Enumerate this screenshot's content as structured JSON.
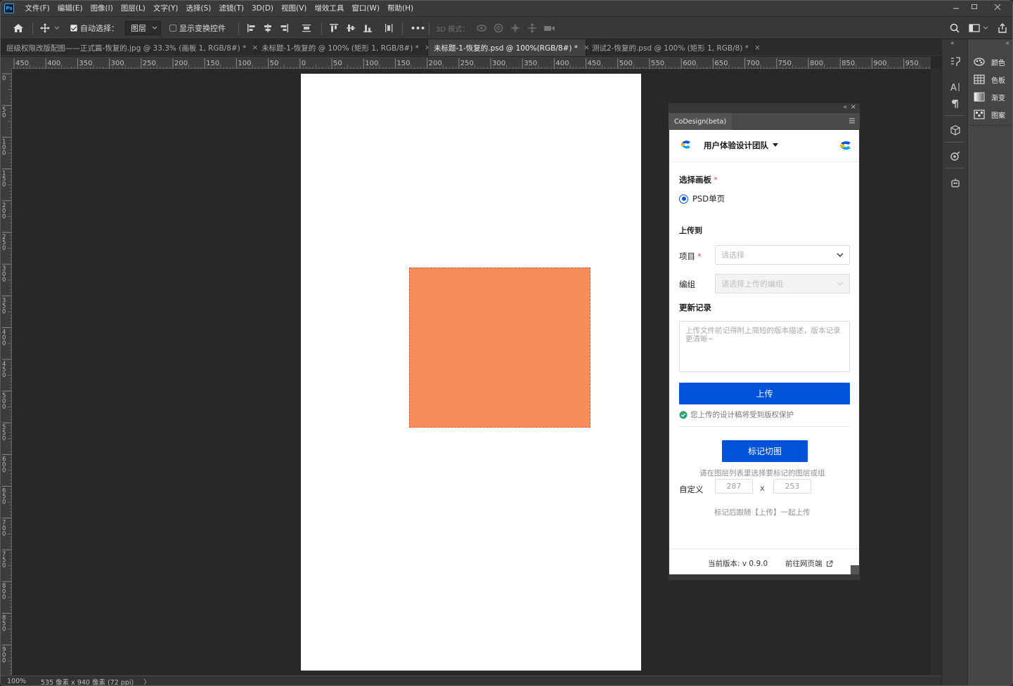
{
  "menu": {
    "logo": "Ps",
    "items": [
      "文件(F)",
      "编辑(E)",
      "图像(I)",
      "图层(L)",
      "文字(Y)",
      "选择(S)",
      "滤镜(T)",
      "3D(D)",
      "视图(V)",
      "增效工具",
      "窗口(W)",
      "帮助(H)"
    ]
  },
  "options": {
    "auto_select_label": "自动选择：",
    "auto_select_value": "图层",
    "show_transform_label": "显示变换控件",
    "more": "•••",
    "mode_3d_label": "3D 模式："
  },
  "tabs": [
    {
      "label": "层级权限改版配图——正式篇-恢复的.jpg @ 33.3% (画板 1, RGB/8#) *",
      "close": "×"
    },
    {
      "label": "未标题-1-恢复的 @ 100% (矩形 1, RGB/8#) *",
      "close": "×"
    },
    {
      "label": "未标题-1-恢复的.psd @ 100%(RGB/8#) *",
      "close": "×"
    },
    {
      "label": "测试2-恢复的.psd @ 100% (矩形 1, RGB/8) *",
      "close": "×"
    }
  ],
  "ruler": {
    "h_ticks": [
      "450",
      "400",
      "350",
      "300",
      "250",
      "200",
      "150",
      "100",
      "50",
      "0",
      "50",
      "100",
      "150",
      "200",
      "250",
      "300",
      "350",
      "400",
      "450",
      "500",
      "550",
      "600",
      "650",
      "700",
      "750",
      "800",
      "850",
      "900",
      "950"
    ],
    "v_ticks": [
      "0",
      "50",
      "100",
      "150",
      "200",
      "250",
      "300",
      "350",
      "400",
      "450",
      "500",
      "550",
      "600",
      "650",
      "700",
      "750",
      "800",
      "850",
      "900"
    ]
  },
  "status": {
    "zoom": "100%",
    "doc_info": "535 像素 x 940 像素 (72 ppi)",
    "arrow": "〉"
  },
  "right_panels": [
    {
      "icon": "color-wheel-icon",
      "label": "颜色"
    },
    {
      "icon": "swatches-icon",
      "label": "色板"
    },
    {
      "icon": "gradient-icon",
      "label": "渐变"
    },
    {
      "icon": "pattern-icon",
      "label": "图案"
    }
  ],
  "codesign": {
    "tab_title": "CoDesign(beta)",
    "team_name": "用户体验设计团队",
    "artboard_label": "选择画板",
    "artboard_option": "PSD单页",
    "upload_to_label": "上传到",
    "project_label": "项目",
    "project_placeholder": "请选择",
    "group_label": "编组",
    "group_placeholder": "请选择上传的编组",
    "update_log_label": "更新记录",
    "update_log_placeholder": "上传文件前记得附上简短的版本描述，版本记录更清晰~",
    "upload_button": "上传",
    "copyright_note": "您上传的设计稿将受到版权保护",
    "mark_slice_button": "标记切图",
    "mark_hint": "请在图层列表里选择要标记的图层或组",
    "custom_label": "自定义",
    "width_value": "287",
    "times": "x",
    "height_value": "253",
    "after_mark_note": "标记后跟随【上传】一起上传",
    "version": "当前版本: v 0.9.0",
    "web_link": "前往网页端",
    "required_mark": "*"
  },
  "colors": {
    "accent": "#0052d9",
    "shape_fill": "#f68e5b",
    "success": "#2ba471"
  }
}
